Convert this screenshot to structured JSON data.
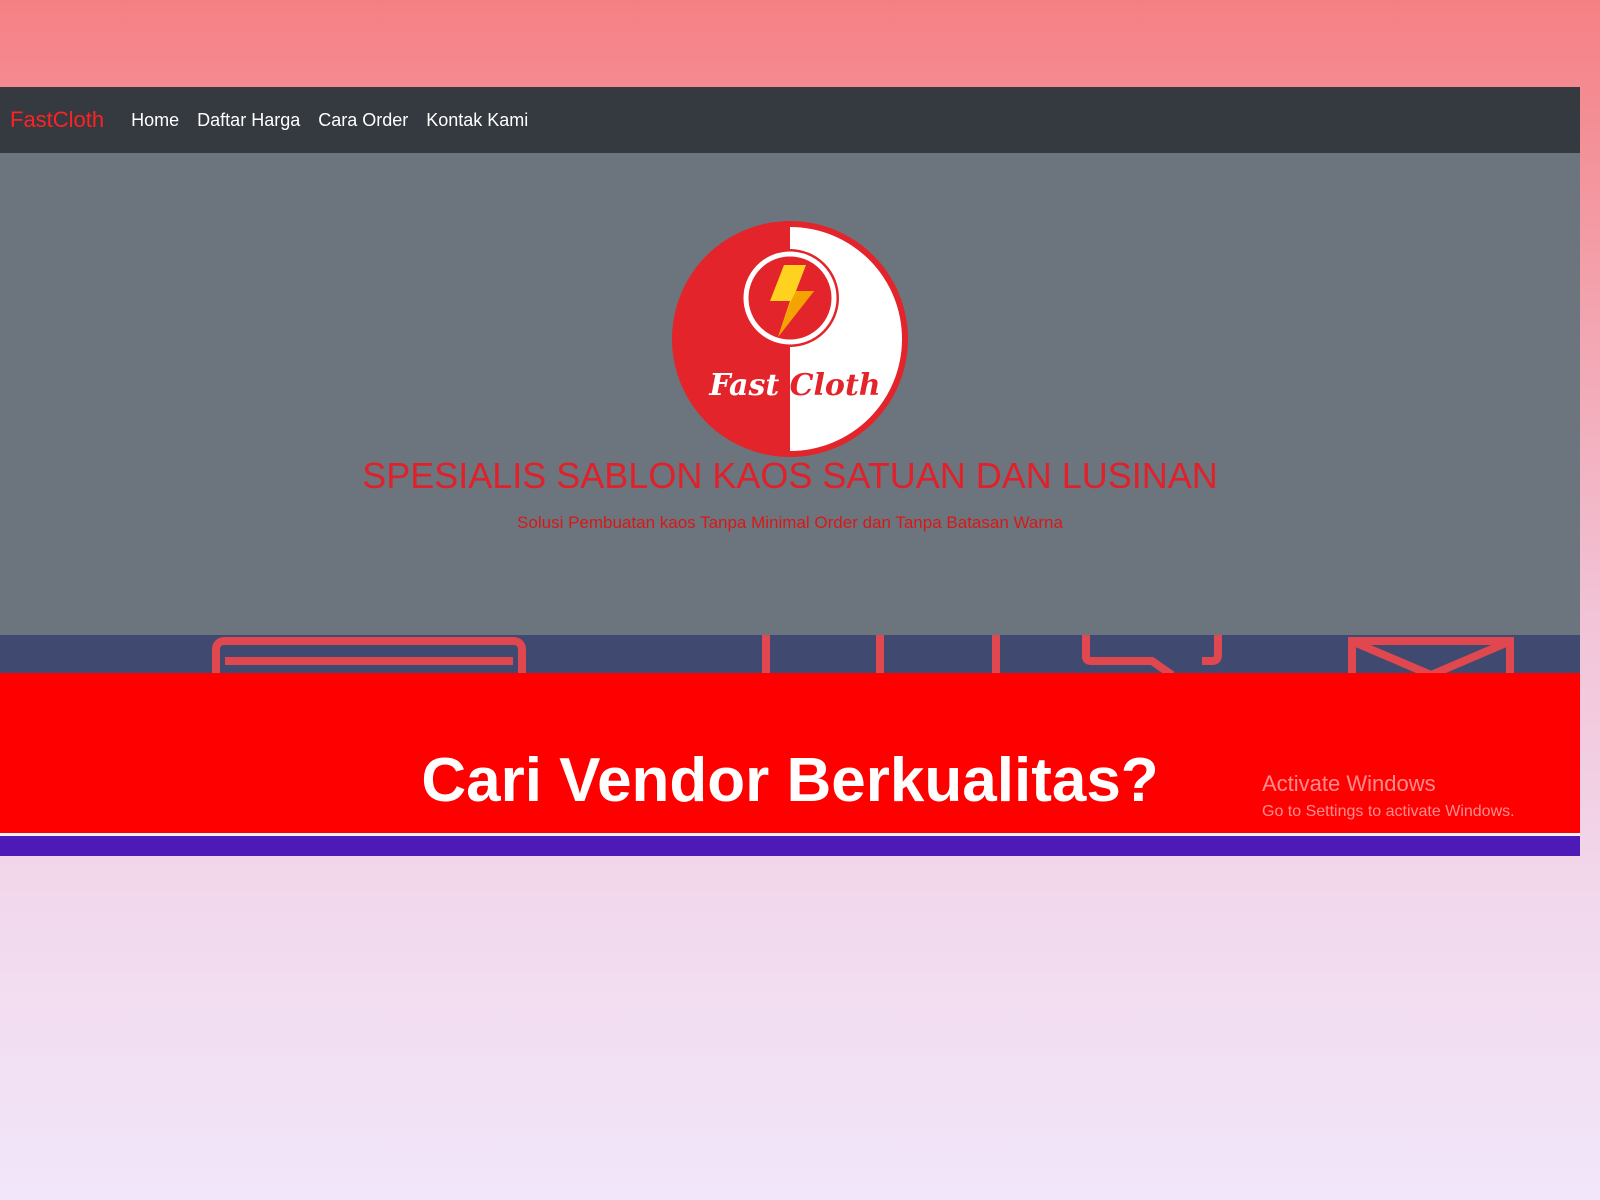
{
  "navbar": {
    "brand": "FastCloth",
    "links": [
      "Home",
      "Daftar Harga",
      "Cara Order",
      "Kontak Kami"
    ]
  },
  "hero": {
    "logo_text": "Fast Cloth",
    "title": "SPESIALIS SABLON KAOS SATUAN DAN LUSINAN",
    "subtitle": "Solusi Pembuatan kaos Tanpa Minimal Order dan Tanpa Batasan Warna"
  },
  "icons": [
    "browser-window-icon",
    "chart-bars-icon",
    "chat-bubble-icon",
    "envelope-icon"
  ],
  "cta": {
    "title": "Cari Vendor Berkualitas?"
  },
  "watermark": {
    "title": "Activate Windows",
    "subtitle": "Go to Settings to activate Windows."
  },
  "colors": {
    "navbar": "#343a40",
    "brand": "#ff2222",
    "hero_bg": "#6c757d",
    "hero_text": "#e0202a",
    "icon_strip": "#404a70",
    "cta_bg": "#ff0000",
    "purple_bar": "#4d1ab8"
  }
}
